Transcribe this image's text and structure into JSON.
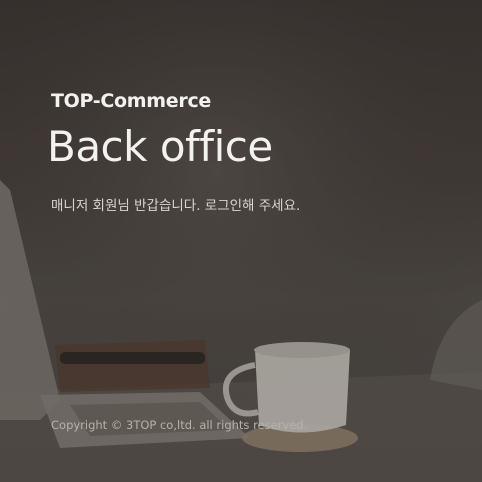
{
  "header": {
    "brand": "TOP-Commerce",
    "title": "Back office",
    "greeting": "매니저 회원님 반갑습니다. 로그인해 주세요."
  },
  "footer": {
    "copyright": "Copyright © 3TOP co,ltd.  all rights reserved."
  }
}
